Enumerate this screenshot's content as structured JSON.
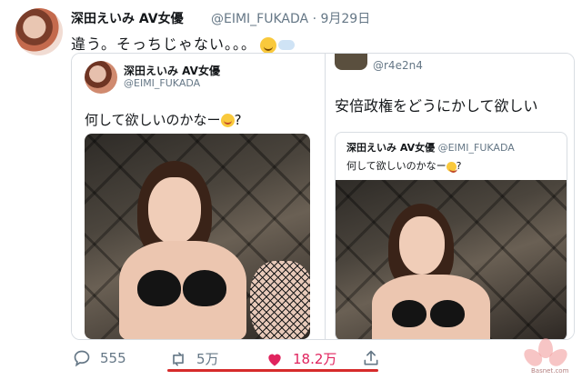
{
  "tweet": {
    "author_name": "深田えいみ AV女優",
    "handle": "@EIMI_FUKADA",
    "date": "9月29日",
    "separator": "·",
    "text": "違う。そっちじゃない。。。",
    "emoji": [
      "relieved-face-icon",
      "speech-cloud-icon"
    ]
  },
  "quoted_left": {
    "author_name": "深田えいみ AV女優",
    "handle": "@EIMI_FUKADA",
    "text": "何して欲しいのかなー",
    "suffix": "?"
  },
  "quoted_right": {
    "handle": "@r4e2n4",
    "text": "安倍政権をどうにかして欲しい",
    "inner": {
      "author_name": "深田えいみ AV女優",
      "handle": "@EIMI_FUKADA",
      "text": "何して欲しいのかなー",
      "suffix": "?"
    }
  },
  "actions": {
    "replies": "555",
    "retweets": "5万",
    "likes": "18.2万",
    "colors": {
      "like": "#e0245e",
      "icon": "#657786",
      "underline": "#d62b2b"
    }
  },
  "watermark": {
    "text": "Basnet.com"
  }
}
